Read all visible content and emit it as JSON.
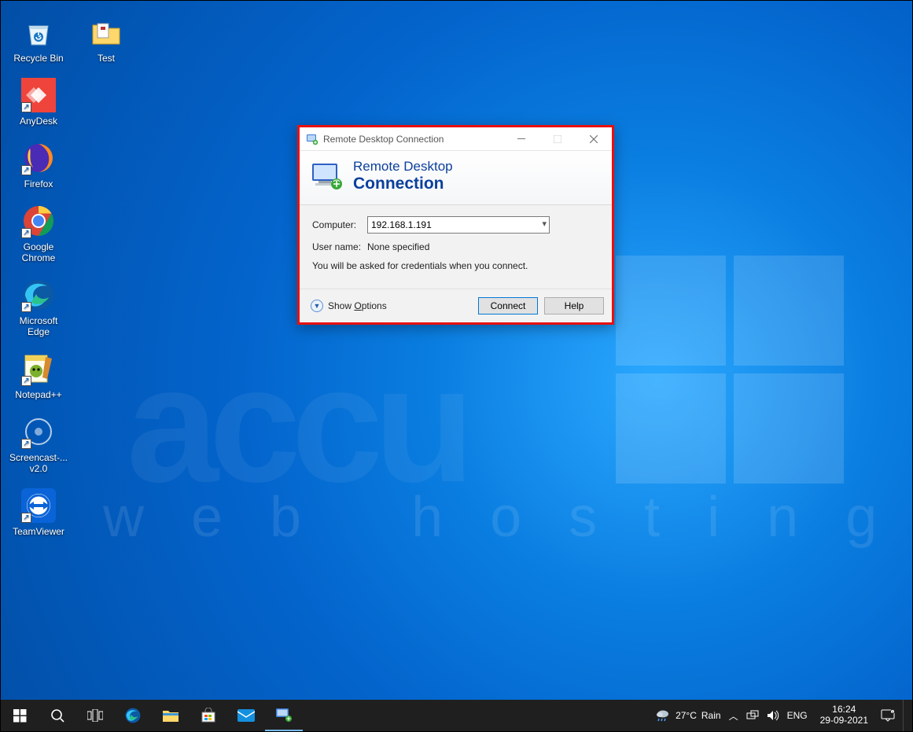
{
  "desktop": {
    "icons_col1": [
      {
        "name": "recycle-bin",
        "label": "Recycle Bin"
      },
      {
        "name": "anydesk",
        "label": "AnyDesk"
      },
      {
        "name": "firefox",
        "label": "Firefox"
      },
      {
        "name": "chrome",
        "label": "Google Chrome"
      },
      {
        "name": "edge",
        "label": "Microsoft Edge"
      },
      {
        "name": "notepadpp",
        "label": "Notepad++"
      },
      {
        "name": "screencast",
        "label": "Screencast-... v2.0"
      },
      {
        "name": "teamviewer",
        "label": "TeamViewer"
      }
    ],
    "icons_col2": [
      {
        "name": "test-folder",
        "label": "Test"
      }
    ]
  },
  "dialog": {
    "title": "Remote Desktop Connection",
    "banner_line1": "Remote Desktop",
    "banner_line2": "Connection",
    "computer_label": "Computer:",
    "computer_value": "192.168.1.191",
    "username_label": "User name:",
    "username_value": "None specified",
    "note": "You will be asked for credentials when you connect.",
    "show_options": "Show Options",
    "connect_btn": "Connect",
    "help_btn": "Help"
  },
  "taskbar": {
    "weather_temp": "27°C",
    "weather_cond": "Rain",
    "lang": "ENG",
    "time": "16:24",
    "date": "29-09-2021"
  },
  "watermark": {
    "l1": "accu",
    "l2": "web hosting"
  }
}
